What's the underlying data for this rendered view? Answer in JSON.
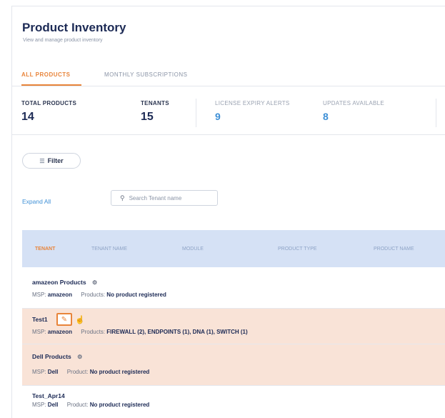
{
  "page": {
    "title": "Product Inventory",
    "subtitle": "View and manage product inventory"
  },
  "tabs": [
    {
      "label": "ALL PRODUCTS",
      "active": true
    },
    {
      "label": "MONTHLY SUBSCRIPTIONS",
      "active": false
    }
  ],
  "stats": [
    {
      "label": "TOTAL PRODUCTS",
      "value": "14"
    },
    {
      "label": "TENANTS",
      "value": "15"
    },
    {
      "label": "LICENSE EXPIRY ALERTS",
      "value": "9"
    },
    {
      "label": "UPDATES AVAILABLE",
      "value": "8"
    }
  ],
  "toolbar": {
    "filter_label": "Filter",
    "expand_all_label": "Expand All",
    "search_placeholder": "Search Tenant name"
  },
  "table": {
    "headers": [
      "TENANT",
      "TENANT NAME",
      "MODULE",
      "PRODUCT TYPE",
      "PRODUCT NAME"
    ],
    "rows": [
      {
        "name": "amazeon Products",
        "msp_label": "MSP:",
        "msp_value": "amazeon",
        "products_label": "Products:",
        "products_value": "No product registered"
      },
      {
        "name": "Test1",
        "msp_label": "MSP:",
        "msp_value": "amazeon",
        "products_label": "Products:",
        "products_value": "FIREWALL (2), ENDPOINTS (1), DNA (1), SWITCH (1)"
      },
      {
        "name": "Dell Products",
        "msp_label": "MSP:",
        "msp_value": "Dell",
        "products_label": "Product:",
        "products_value": "No product registered"
      },
      {
        "name": "Test_Apr14",
        "msp_label": "MSP:",
        "msp_value": "Dell",
        "products_label": "Product:",
        "products_value": "No product registered"
      }
    ]
  },
  "colors": {
    "accent": "#e8843a",
    "link": "#3d8fd6",
    "header_bg": "#d5e1f5",
    "highlight_row": "#f9e3d7"
  }
}
